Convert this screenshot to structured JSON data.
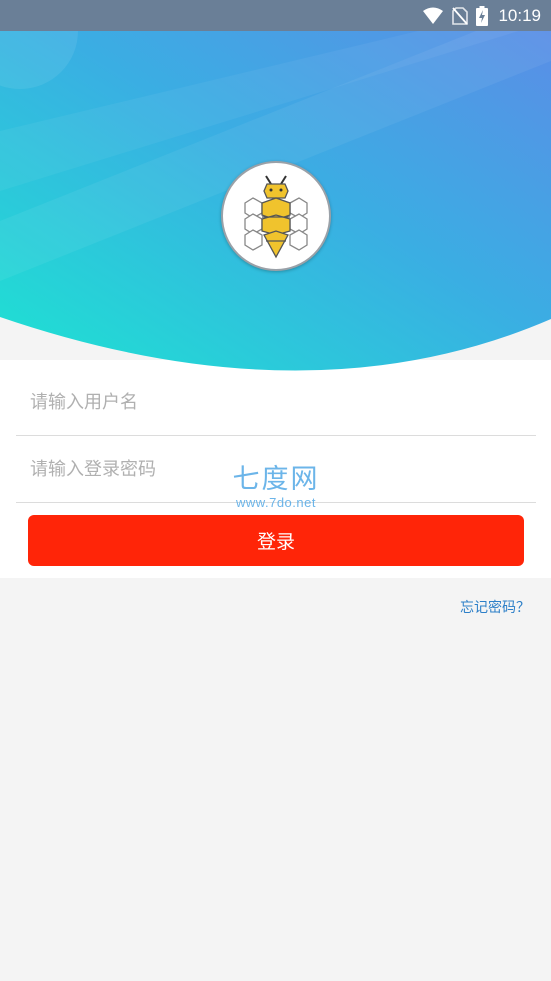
{
  "status_bar": {
    "time": "10:19",
    "icons": [
      "wifi-icon",
      "no-sim-icon",
      "battery-charging-icon"
    ]
  },
  "header": {
    "logo_icon": "bee-honeycomb-logo",
    "gradient_colors": [
      "#1de3d2",
      "#3aaee3",
      "#5a8ee6"
    ]
  },
  "login_form": {
    "username_placeholder": "请输入用户名",
    "password_placeholder": "请输入登录密码",
    "username_value": "",
    "password_value": "",
    "login_label": "登录",
    "forgot_password_label": "忘记密码？"
  },
  "watermark": {
    "text": "七度网",
    "url": "www.7do.net"
  },
  "colors": {
    "primary_button": "#ff2508",
    "link": "#2c7fc8",
    "background": "#f4f4f4",
    "card": "#ffffff"
  }
}
